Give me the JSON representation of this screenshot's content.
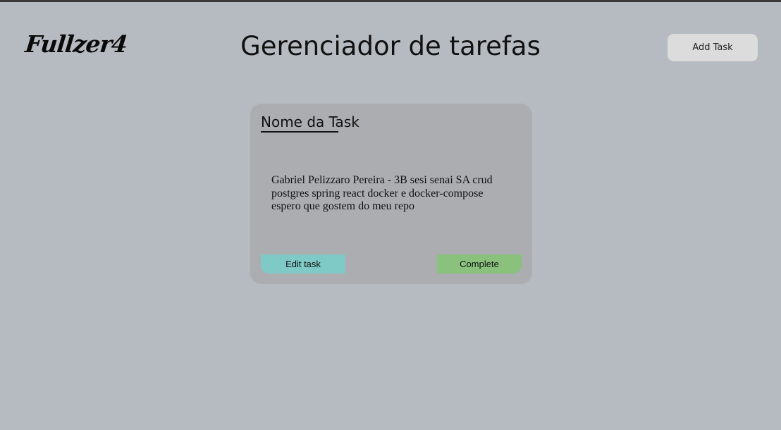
{
  "header": {
    "logo_text": "Fullzer4",
    "title": "Gerenciador de tarefas",
    "add_task_label": "Add Task"
  },
  "task_card": {
    "title": "Nome da Task",
    "description": "Gabriel Pelizzaro Pereira - 3B sesi senai SA crud\npostgres spring react docker e docker-compose\nespero que gostem do meu repo",
    "edit_label": "Edit task",
    "complete_label": "Complete"
  },
  "colors": {
    "background": "#b6bbc2",
    "card": "#acadb0",
    "edit_button": "#7fcac6",
    "complete_button": "#8ac27d",
    "add_button": "#dcdcdc"
  }
}
